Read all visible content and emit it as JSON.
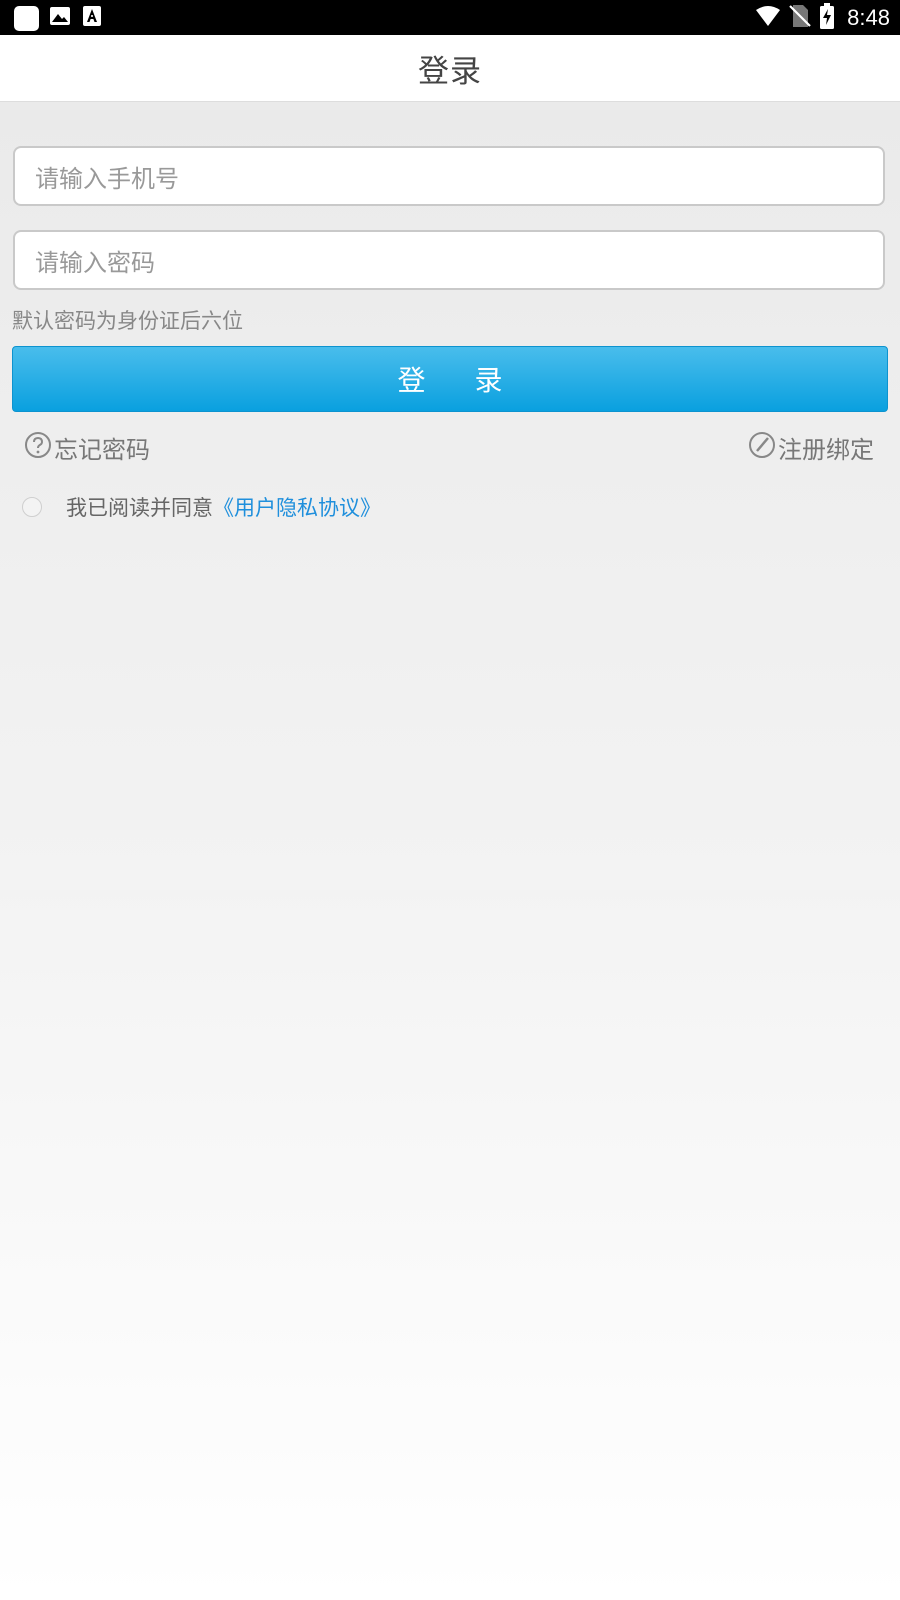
{
  "status_bar": {
    "time": "8:48",
    "icons_left": [
      "app-icon",
      "image-icon",
      "font-icon"
    ],
    "icons_right": [
      "wifi-icon",
      "no-sim-icon",
      "battery-charging-icon"
    ]
  },
  "header": {
    "title": "登录"
  },
  "form": {
    "phone_placeholder": "请输入手机号",
    "password_placeholder": "请输入密码",
    "hint": "默认密码为身份证后六位",
    "login_button": "登 录"
  },
  "links": {
    "forgot_password": "忘记密码",
    "register_bind": "注册绑定"
  },
  "agreement": {
    "text": "我已阅读并同意",
    "link": "《用户隐私协议》",
    "checked": false
  },
  "colors": {
    "accent": "#0aa0df",
    "link": "#1f8fdc",
    "status_bar": "#000000"
  }
}
